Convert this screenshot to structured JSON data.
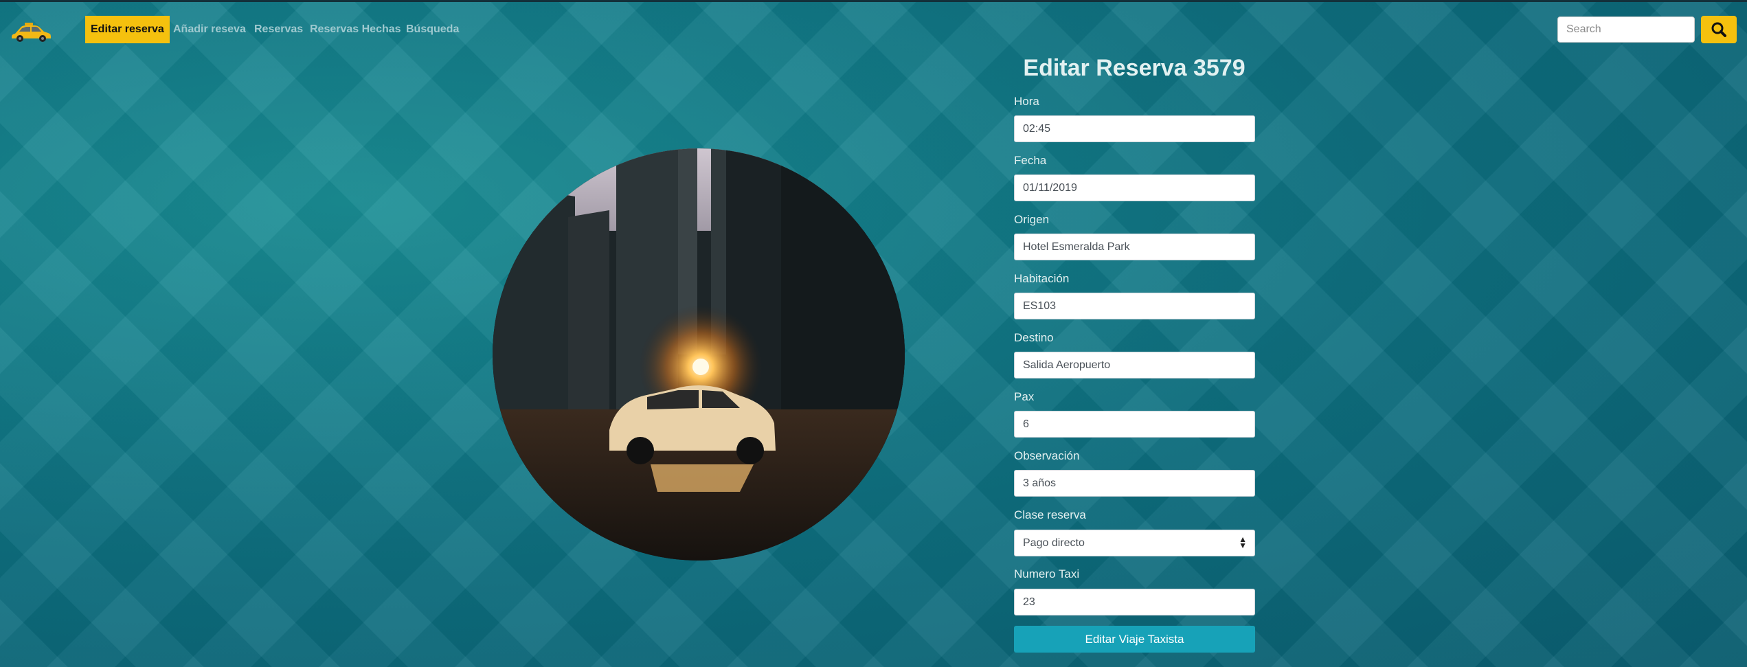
{
  "nav": {
    "brand_icon": "taxi-car-icon",
    "items": [
      {
        "label": "Editar reserva",
        "active": true
      },
      {
        "label": "Añadir reseva",
        "active": false
      },
      {
        "label": "Reservas",
        "active": false
      },
      {
        "label": "Reservas Hechas",
        "active": false
      },
      {
        "label": "Búsqueda",
        "active": false
      }
    ],
    "search_placeholder": "Search",
    "search_icon": "search-icon"
  },
  "hero": {
    "image": "taxi-street-sunset-photo"
  },
  "form": {
    "title": "Editar Reserva 3579",
    "fields": {
      "hora": {
        "label": "Hora",
        "value": "02:45"
      },
      "fecha": {
        "label": "Fecha",
        "value": "01/11/2019"
      },
      "origen": {
        "label": "Origen",
        "value": "Hotel Esmeralda Park"
      },
      "habitacion": {
        "label": "Habitación",
        "value": "ES103"
      },
      "destino": {
        "label": "Destino",
        "value": "Salida Aeropuerto"
      },
      "pax": {
        "label": "Pax",
        "value": "6"
      },
      "observacion": {
        "label": "Observación",
        "value": "3 años"
      },
      "clase": {
        "label": "Clase reserva",
        "value": "Pago directo"
      },
      "taxi": {
        "label": "Numero Taxi",
        "value": "23"
      }
    },
    "submit_label": "Editar Viaje Taxista"
  },
  "colors": {
    "accent": "#f5c10e",
    "button": "#17a2b8",
    "background": "#0f7485"
  }
}
